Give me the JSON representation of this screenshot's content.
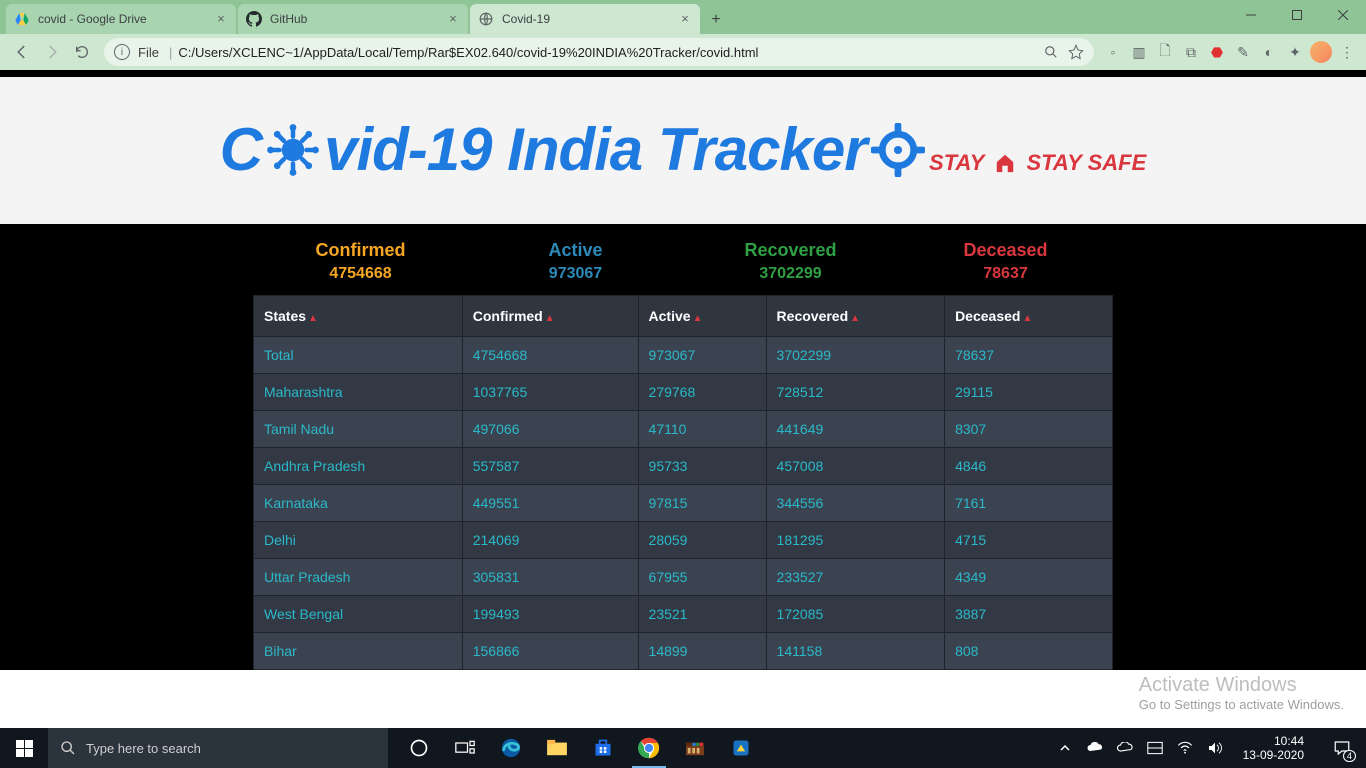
{
  "browser": {
    "tabs": [
      {
        "title": "covid - Google Drive"
      },
      {
        "title": "GitHub"
      },
      {
        "title": "Covid-19"
      }
    ],
    "active_tab_index": 2,
    "omnibox": {
      "file_label": "File",
      "url": "C:/Users/XCLENC~1/AppData/Local/Temp/Rar$EX02.640/covid-19%20INDIA%20Tracker/covid.html"
    }
  },
  "page": {
    "title_parts": {
      "a": "C",
      "b": "vid-19 India Tracker"
    },
    "subtitle_parts": {
      "a": "STAY",
      "b": "STAY SAFE"
    },
    "stats": {
      "confirmed": {
        "label": "Confirmed",
        "value": "4754668"
      },
      "active": {
        "label": "Active",
        "value": "973067"
      },
      "recovered": {
        "label": "Recovered",
        "value": "3702299"
      },
      "deceased": {
        "label": "Deceased",
        "value": "78637"
      }
    },
    "columns": {
      "c0": "States",
      "c1": "Confirmed",
      "c2": "Active",
      "c3": "Recovered",
      "c4": "Deceased"
    },
    "rows": [
      {
        "state": "Total",
        "confirmed": "4754668",
        "active": "973067",
        "recovered": "3702299",
        "deceased": "78637"
      },
      {
        "state": "Maharashtra",
        "confirmed": "1037765",
        "active": "279768",
        "recovered": "728512",
        "deceased": "29115"
      },
      {
        "state": "Tamil Nadu",
        "confirmed": "497066",
        "active": "47110",
        "recovered": "441649",
        "deceased": "8307"
      },
      {
        "state": "Andhra Pradesh",
        "confirmed": "557587",
        "active": "95733",
        "recovered": "457008",
        "deceased": "4846"
      },
      {
        "state": "Karnataka",
        "confirmed": "449551",
        "active": "97815",
        "recovered": "344556",
        "deceased": "7161"
      },
      {
        "state": "Delhi",
        "confirmed": "214069",
        "active": "28059",
        "recovered": "181295",
        "deceased": "4715"
      },
      {
        "state": "Uttar Pradesh",
        "confirmed": "305831",
        "active": "67955",
        "recovered": "233527",
        "deceased": "4349"
      },
      {
        "state": "West Bengal",
        "confirmed": "199493",
        "active": "23521",
        "recovered": "172085",
        "deceased": "3887"
      },
      {
        "state": "Bihar",
        "confirmed": "156866",
        "active": "14899",
        "recovered": "141158",
        "deceased": "808"
      }
    ]
  },
  "watermark": {
    "l1": "Activate Windows",
    "l2": "Go to Settings to activate Windows."
  },
  "taskbar": {
    "search_placeholder": "Type here to search",
    "clock_time": "10:44",
    "clock_date": "13-09-2020",
    "notif_count": "4"
  }
}
